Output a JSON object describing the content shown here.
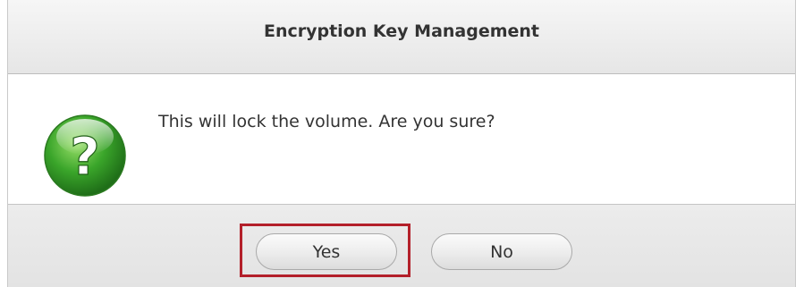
{
  "dialog": {
    "title": "Encryption Key Management",
    "message": "This will lock the volume. Are you sure?",
    "icon": "question-icon",
    "icon_color": "#3aa52a",
    "buttons": {
      "yes_label": "Yes",
      "no_label": "No"
    },
    "highlight_color": "#b3202a"
  }
}
